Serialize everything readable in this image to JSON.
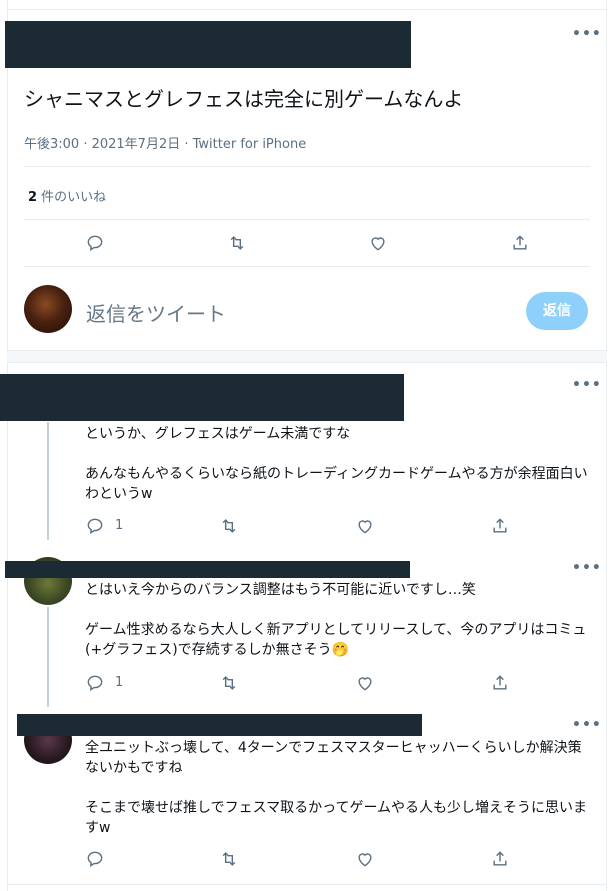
{
  "main": {
    "text": "シャニマスとグレフェスは完全に別ゲームなんよ",
    "meta": "午後3:00 · 2021年7月2日 · Twitter for iPhone",
    "likes_count": "2",
    "likes_label": " 件のいいね",
    "more": "•••"
  },
  "compose": {
    "placeholder": "返信をツイート",
    "button": "返信"
  },
  "replies": [
    {
      "text": "というか、グレフェスはゲーム未満ですな\n\nあんなもんやるくらいなら紙のトレーディングカードゲームやる方が余程面白いわというw",
      "reply_count": "1",
      "more": "•••"
    },
    {
      "text": "とはいえ今からのバランス調整はもう不可能に近いですし…笑\n\nゲーム性求めるなら大人しく新アプリとしてリリースして、今のアプリはコミュ(+グラフェス)で存続するしか無さそう🤭",
      "reply_count": "1",
      "more": "•••"
    },
    {
      "text": "全ユニットぶっ壊して、4ターンでフェスマスターヒャッハーくらいしか解決策ないかもですね\n\nそこまで壊せば推しでフェスマ取るかってゲームやる人も少し増えそうに思いますw",
      "reply_count": "",
      "more": "•••"
    }
  ],
  "colors": {
    "icon_gray": "#5b7083",
    "accent_light": "#8ed0f9",
    "redaction": "#1c2a33"
  },
  "icons": [
    "reply-icon",
    "retweet-icon",
    "like-icon",
    "share-icon",
    "more-icon"
  ]
}
